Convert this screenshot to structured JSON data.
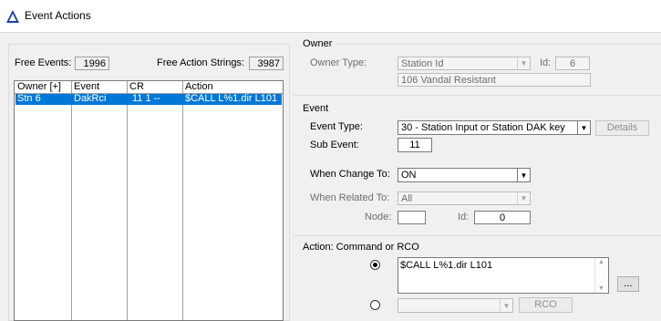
{
  "window": {
    "title": "Event Actions"
  },
  "left": {
    "free_events_label": "Free Events:",
    "free_events_value": "1996",
    "free_actions_label": "Free Action Strings:",
    "free_actions_value": "3987",
    "list": {
      "columns": [
        "Owner [+]",
        "Event",
        "CR",
        "Action"
      ],
      "rows": [
        {
          "owner": "Stn 6",
          "event": "DakRci",
          "cr": "11 1 --",
          "action": "$CALL L%1.dir L101",
          "selected": true
        }
      ]
    }
  },
  "owner": {
    "group_label": "Owner",
    "type_label": "Owner Type:",
    "type_value": "Station Id",
    "id_label": "Id:",
    "id_value": "6",
    "description": "106 Vandal Resistant"
  },
  "event": {
    "group_label": "Event",
    "type_label": "Event Type:",
    "type_value": "30 - Station Input or Station DAK key",
    "details_button": "Details",
    "sub_event_label": "Sub Event:",
    "sub_event_value": "11",
    "when_change_label": "When Change To:",
    "when_change_value": "ON",
    "when_related_label": "When Related To:",
    "when_related_value": "All",
    "node_label": "Node:",
    "node_value": "",
    "id_label": "Id:",
    "id_value": "0"
  },
  "action": {
    "group_label": "Action: Command or RCO",
    "command_text": "$CALL L%1.dir L101",
    "browse_button": "...",
    "rco_value": "",
    "rco_button": "RCO",
    "selected_option": "command"
  },
  "colors": {
    "selection": "#0078d7",
    "title_icon": "#1c3fa8"
  }
}
